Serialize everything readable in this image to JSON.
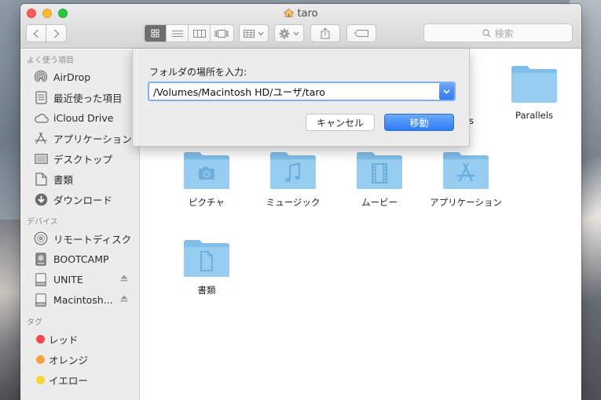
{
  "window": {
    "title": "taro"
  },
  "toolbar": {
    "search_placeholder": "検索"
  },
  "sidebar": {
    "favorites_header": "よく使う項目",
    "favorites": [
      {
        "label": "AirDrop",
        "icon": "airdrop-icon"
      },
      {
        "label": "最近使った項目",
        "icon": "recents-icon"
      },
      {
        "label": "iCloud Drive",
        "icon": "cloud-icon"
      },
      {
        "label": "アプリケーション",
        "icon": "applications-icon"
      },
      {
        "label": "デスクトップ",
        "icon": "desktop-icon"
      },
      {
        "label": "書類",
        "icon": "documents-icon"
      },
      {
        "label": "ダウンロード",
        "icon": "downloads-icon"
      }
    ],
    "devices_header": "デバイス",
    "devices": [
      {
        "label": "リモートディスク",
        "icon": "remote-disc-icon"
      },
      {
        "label": "BOOTCAMP",
        "icon": "internal-disk-icon"
      },
      {
        "label": "UNITE",
        "icon": "external-disk-icon"
      },
      {
        "label": "Macintosh...",
        "icon": "external-disk-icon"
      }
    ],
    "tags_header": "タグ",
    "tags": [
      {
        "label": "レッド",
        "color": "#f5484e"
      },
      {
        "label": "オレンジ",
        "color": "#f5a142"
      },
      {
        "label": "イエロー",
        "color": "#f5d33b"
      }
    ]
  },
  "content": {
    "partial_label": "s",
    "folders": [
      {
        "label": "Parallels",
        "icon": "folder-icon"
      },
      {
        "label": "ピクチャ",
        "icon": "pictures-folder-icon"
      },
      {
        "label": "ミュージック",
        "icon": "music-folder-icon"
      },
      {
        "label": "ムービー",
        "icon": "movies-folder-icon"
      },
      {
        "label": "アプリケーション",
        "icon": "applications-folder-icon"
      },
      {
        "label": "書類",
        "icon": "documents-folder-icon"
      }
    ]
  },
  "sheet": {
    "prompt": "フォルダの場所を入力:",
    "path_value": "/Volumes/Macintosh HD/ユーザ/taro",
    "cancel_label": "キャンセル",
    "go_label": "移動"
  },
  "colors": {
    "accent": "#2d7cf6",
    "folder": "#8ec9f2"
  }
}
